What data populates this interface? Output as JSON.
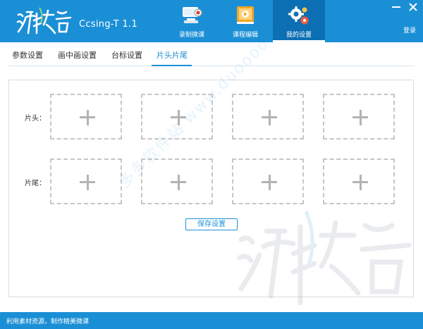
{
  "header": {
    "app_title": "Ccsing-T 1.1",
    "brand_color": "#1b8fd6",
    "active_tab_color": "#0c6fb3",
    "nav_tabs": [
      {
        "label": "录制微课",
        "icon": "camera-icon"
      },
      {
        "label": "课程编辑",
        "icon": "course-edit-icon"
      },
      {
        "label": "我的设置",
        "icon": "settings-gears-icon"
      }
    ],
    "active_nav": "我的设置",
    "window_controls": [
      "minimize-icon",
      "close-icon"
    ],
    "login_label": "登录"
  },
  "subtabs": {
    "items": [
      {
        "label": "参数设置"
      },
      {
        "label": "画中画设置"
      },
      {
        "label": "台标设置"
      },
      {
        "label": "片头片尾"
      }
    ],
    "active": "片头片尾"
  },
  "intro_outro": {
    "header_label": "片头：",
    "footer_label": "片尾：",
    "slot_icon": "plus-icon",
    "save_label": "保存设置"
  },
  "watermark": {
    "site_text": "多多软件站 www.duoooo.com"
  },
  "footer": {
    "text": "利用素材资源，制作精美微课"
  }
}
